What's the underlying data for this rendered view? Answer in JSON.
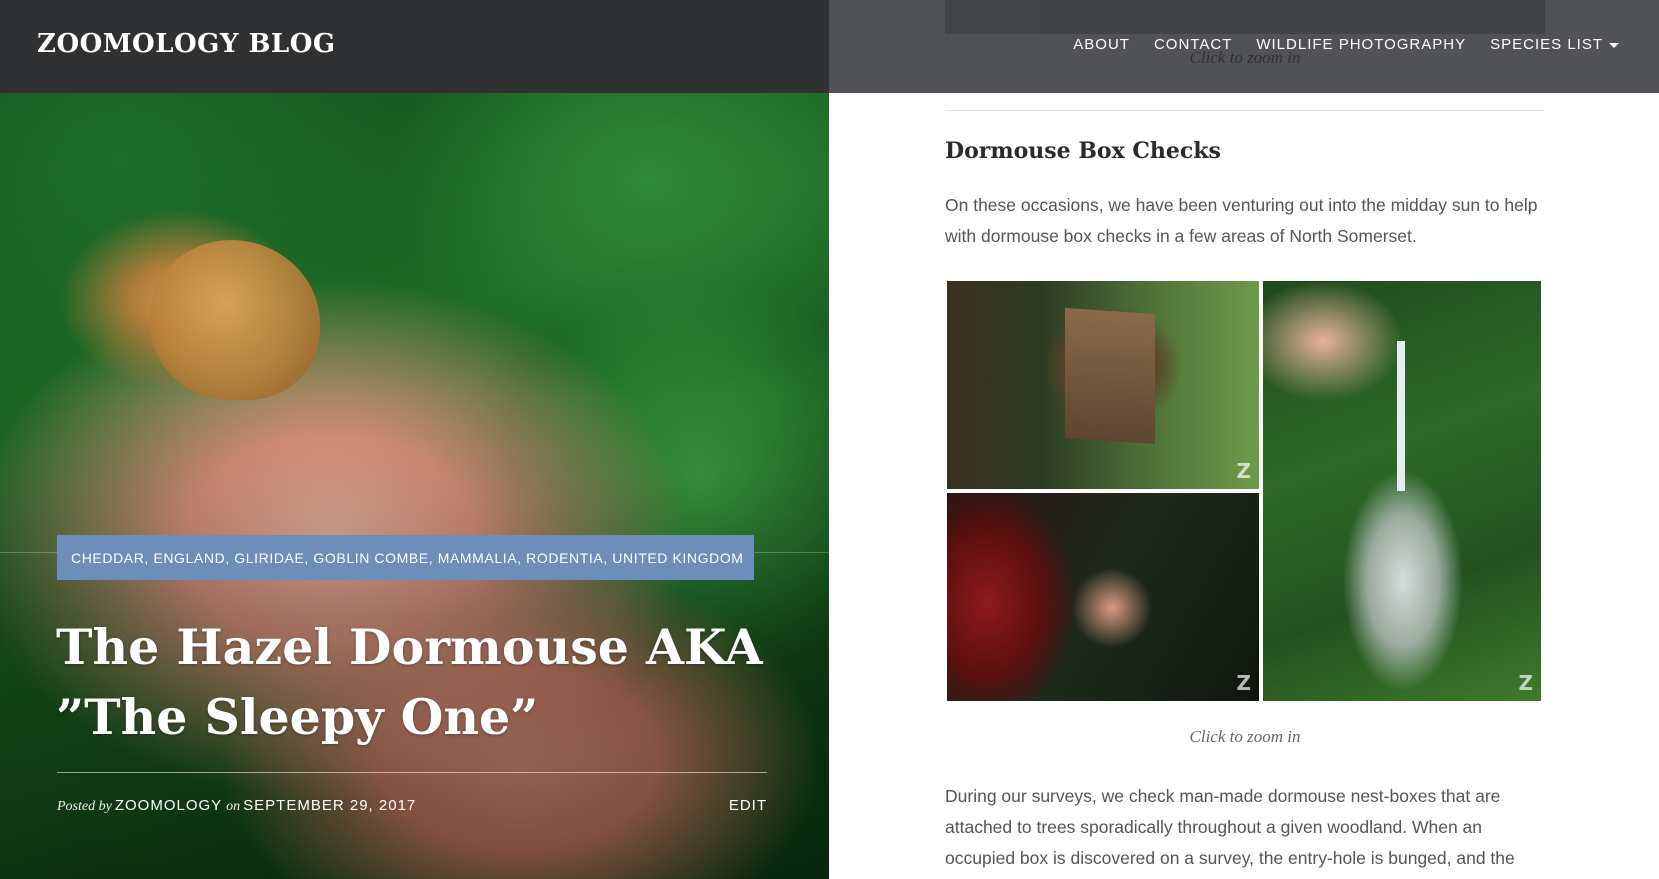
{
  "header": {
    "site_title": "ZOOMOLOGY BLOG",
    "nav": [
      {
        "label": "ABOUT"
      },
      {
        "label": "CONTACT"
      },
      {
        "label": "WILDLIFE PHOTOGRAPHY"
      },
      {
        "label": "SPECIES LIST",
        "has_dropdown": true
      }
    ]
  },
  "hero": {
    "categories": "CHEDDAR, ENGLAND, GLIRIDAE, GOBLIN COMBE, MAMMALIA, RODENTIA, UNITED KINGDOM",
    "title_line1": "The Hazel Dormouse AKA",
    "title_line2": "”The Sleepy One”",
    "meta": {
      "posted_by_prefix": "Posted by",
      "author": "ZOOMOLOGY",
      "on_prefix": "on",
      "date": "SEPTEMBER 29, 2017",
      "edit_label": "EDIT"
    },
    "colors": {
      "category_bg": "#6d8dba",
      "header_bg": "#2f3032"
    }
  },
  "content": {
    "top_caption": "Click to zoom in",
    "section_heading": "Dormouse Box Checks",
    "paragraph1_line1": "On these occasions, we have been venturing out into the midday sun to help",
    "paragraph1_line2": "with dormouse box checks in a few areas of North Somerset.",
    "gallery": {
      "images": [
        {
          "name": "dormouse-nest-box-on-tree",
          "watermark": "Z"
        },
        {
          "name": "weighing-scale-with-bag",
          "watermark": "Z"
        },
        {
          "name": "hand-reaching-into-box",
          "watermark": "Z"
        }
      ],
      "caption": "Click to zoom in"
    },
    "paragraph2_line1": "During our surveys, we check man-made dormouse nest-boxes that are",
    "paragraph2_line2": "attached to trees sporadically throughout a given woodland. When an",
    "paragraph2_line3": "occupied box is discovered on a survey, the entry-hole is bunged, and the box"
  }
}
